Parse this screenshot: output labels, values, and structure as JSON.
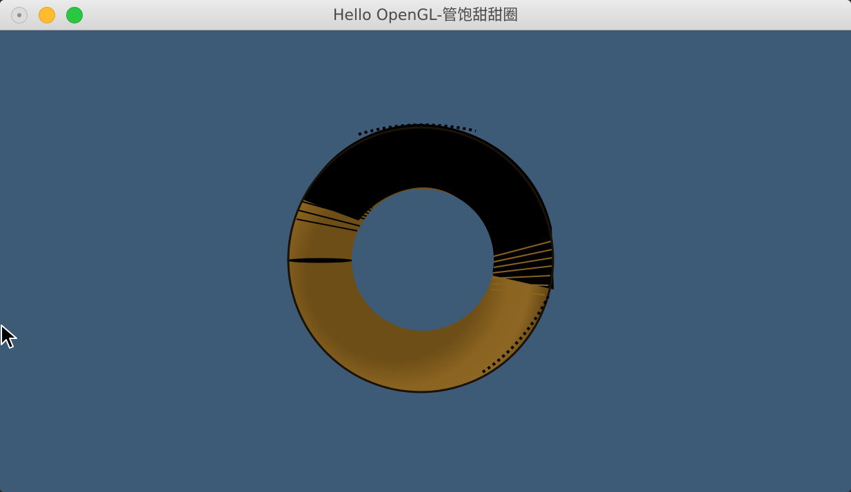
{
  "window": {
    "title": "Hello OpenGL-管饱甜甜圈"
  },
  "controls": {
    "close": "close-button",
    "minimize": "minimize-button",
    "zoom": "zoom-button"
  },
  "scene": {
    "background_color": "#3d5a76",
    "torus_color": "#8a6420",
    "shadow_color": "#000000"
  },
  "cursor": {
    "icon": "arrow-cursor-icon"
  }
}
